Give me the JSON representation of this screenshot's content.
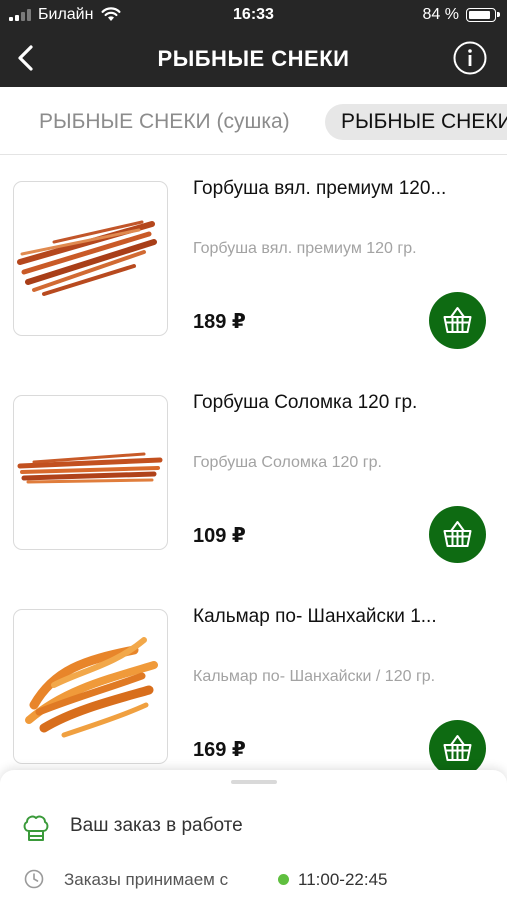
{
  "status_bar": {
    "carrier": "Билайн",
    "time": "16:33",
    "battery": "84 %",
    "battery_level": 0.84
  },
  "nav": {
    "title": "РЫБНЫЕ СНЕКИ",
    "back_icon": "chevron-left-icon",
    "info_icon": "info-icon"
  },
  "tabs": [
    {
      "label": "РЫБНЫЕ СНЕКИ (сушка)",
      "active": false
    },
    {
      "label": "РЫБНЫЕ СНЕКИ",
      "active": true
    }
  ],
  "products": [
    {
      "name": "Горбуша вял. премиум 120...",
      "desc": "Горбуша вял. премиум 120 гр.",
      "price": "189 ₽"
    },
    {
      "name": "Горбуша Соломка 120 гр.",
      "desc": "Горбуша Соломка 120 гр.",
      "price": "109 ₽"
    },
    {
      "name": "Кальмар по- Шанхайски 1...",
      "desc": "Кальмар по- Шанхайски / 120 гр.",
      "price": "169 ₽"
    }
  ],
  "colors": {
    "header_bg": "#262626",
    "cart_button": "#0e6b12",
    "accent_green": "#3a9a3a",
    "open_dot": "#5fbf3f"
  },
  "sheet": {
    "order_status": "Ваш заказ в работе",
    "hours_label": "Заказы принимаем с",
    "hours": "11:00-22:45"
  }
}
